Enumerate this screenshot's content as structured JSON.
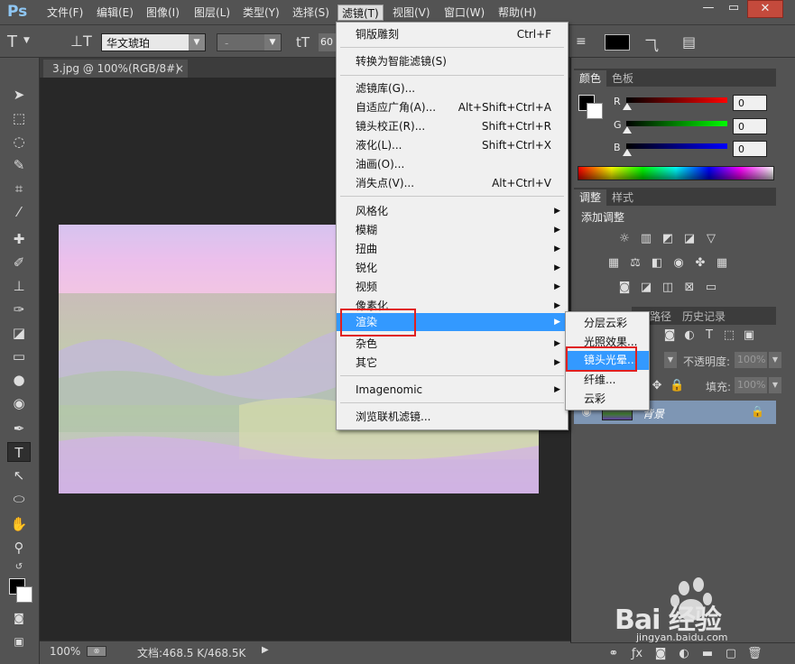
{
  "app": {
    "logo": "Ps"
  },
  "menubar": {
    "items": [
      "文件(F)",
      "编辑(E)",
      "图像(I)",
      "图层(L)",
      "类型(Y)",
      "选择(S)",
      "滤镜(T)",
      "视图(V)",
      "窗口(W)",
      "帮助(H)"
    ],
    "active_index": 6
  },
  "window_buttons": {
    "minimize": "—",
    "maximize": "▭",
    "close": "✕"
  },
  "options_bar": {
    "font_family": "华文琥珀",
    "font_style": "-",
    "font_size": "60"
  },
  "document": {
    "tab_title": "3.jpg @ 100%(RGB/8#) *",
    "tab_close": "×"
  },
  "status_bar": {
    "zoom": "100%",
    "doc_info": "文档:468.5 K/468.5K",
    "arrow": "▶"
  },
  "filter_menu": {
    "items": [
      {
        "label": "铜版雕刻",
        "shortcut": "Ctrl+F"
      },
      {
        "label": "转换为智能滤镜(S)"
      },
      {
        "label": "滤镜库(G)..."
      },
      {
        "label": "自适应广角(A)...",
        "shortcut": "Alt+Shift+Ctrl+A"
      },
      {
        "label": "镜头校正(R)...",
        "shortcut": "Shift+Ctrl+R"
      },
      {
        "label": "液化(L)...",
        "shortcut": "Shift+Ctrl+X"
      },
      {
        "label": "油画(O)..."
      },
      {
        "label": "消失点(V)...",
        "shortcut": "Alt+Ctrl+V"
      },
      {
        "label": "风格化"
      },
      {
        "label": "模糊"
      },
      {
        "label": "扭曲"
      },
      {
        "label": "锐化"
      },
      {
        "label": "视频"
      },
      {
        "label": "像素化"
      },
      {
        "label": "渲染"
      },
      {
        "label": "杂色"
      },
      {
        "label": "其它"
      },
      {
        "label": "Imagenomic"
      },
      {
        "label": "浏览联机滤镜..."
      }
    ],
    "submenu_arrow": "▶"
  },
  "render_submenu": {
    "items": [
      "分层云彩",
      "光照效果...",
      "镜头光晕...",
      "纤维...",
      "云彩"
    ],
    "highlighted_index": 2
  },
  "color_panel": {
    "tabs": [
      "颜色",
      "色板"
    ],
    "channels": [
      {
        "label": "R",
        "value": "0"
      },
      {
        "label": "G",
        "value": "0"
      },
      {
        "label": "B",
        "value": "0"
      }
    ]
  },
  "adjust_panel": {
    "tabs": [
      "调整",
      "样式"
    ],
    "title": "添加调整"
  },
  "layers_panel": {
    "tabs": [
      "路径",
      "历史记录"
    ],
    "opacity_label": "不透明度:",
    "opacity_value": "100%",
    "fill_label": "填充:",
    "fill_value": "100%",
    "layer_name": "背景"
  },
  "watermark": {
    "brand": "Bai 经验",
    "url": "jingyan.baidu.com"
  },
  "colors": {
    "menu_highlight": "#3399ff",
    "annotation_red": "#e02020",
    "layer_selected": "#7e96b4"
  }
}
